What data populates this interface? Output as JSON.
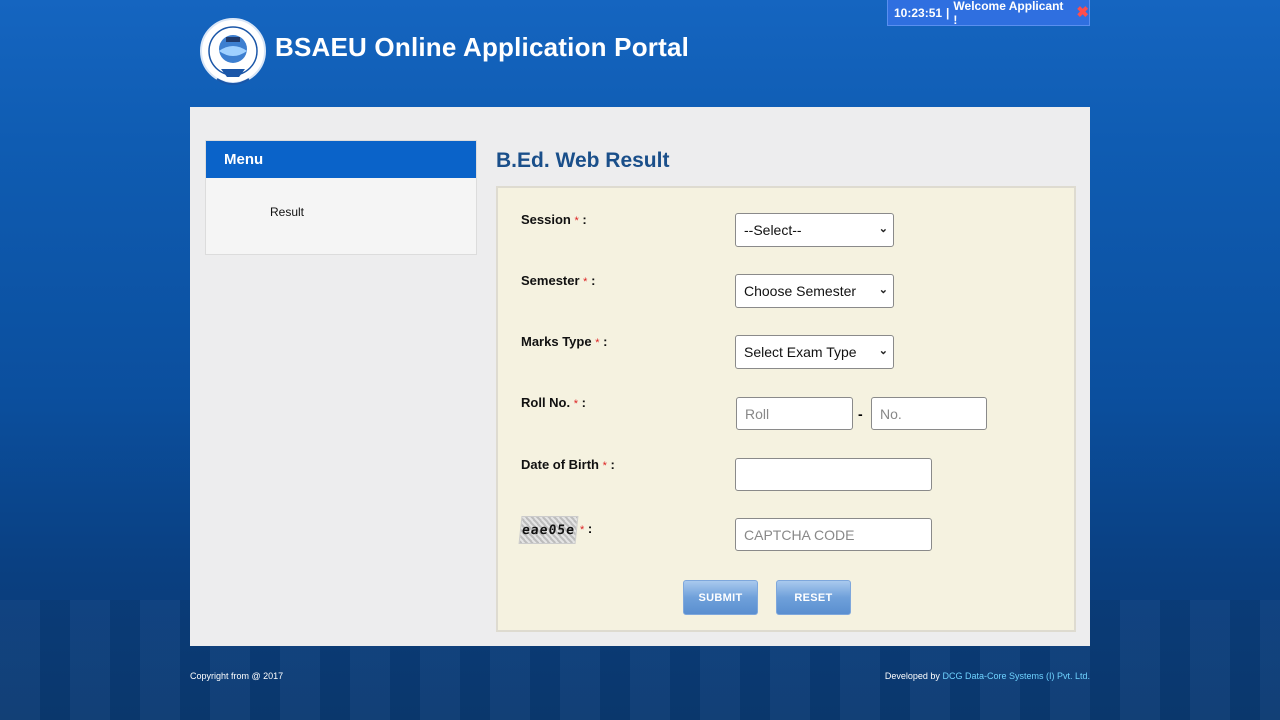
{
  "header": {
    "clock": "10:23:51",
    "separator": "|",
    "welcome": "Welcome Applicant !",
    "close_icon": "x-icon",
    "site_title": "BSAEU Online Application Portal",
    "logo_icon": "university-seal-icon"
  },
  "menu": {
    "title": "Menu",
    "items": [
      {
        "label": "Result"
      }
    ]
  },
  "page": {
    "title": "B.Ed. Web Result"
  },
  "form": {
    "session": {
      "label": "Session",
      "value": "--Select--"
    },
    "semester": {
      "label": "Semester",
      "value": "Choose Semester"
    },
    "marks_type": {
      "label": "Marks Type",
      "value": "Select Exam Type"
    },
    "roll": {
      "label": "Roll No.",
      "roll_placeholder": "Roll",
      "separator": "-",
      "no_placeholder": "No."
    },
    "dob": {
      "label": "Date of Birth",
      "value": ""
    },
    "captcha": {
      "image_text": "eae05e",
      "placeholder": "CAPTCHA CODE"
    },
    "required_mark": "*",
    "colon": ":",
    "submit_label": "SUBMIT",
    "reset_label": "RESET"
  },
  "footer": {
    "copyright": "Copyright from @ 2017",
    "developed_by": "Developed by",
    "developer_link": "DCG Data-Core Systems (I) Pvt. Ltd."
  },
  "colors": {
    "brand_blue": "#0a63c9",
    "title_blue": "#1a4f8a",
    "form_bg": "#f5f2e0",
    "required_red": "#dd2222"
  }
}
